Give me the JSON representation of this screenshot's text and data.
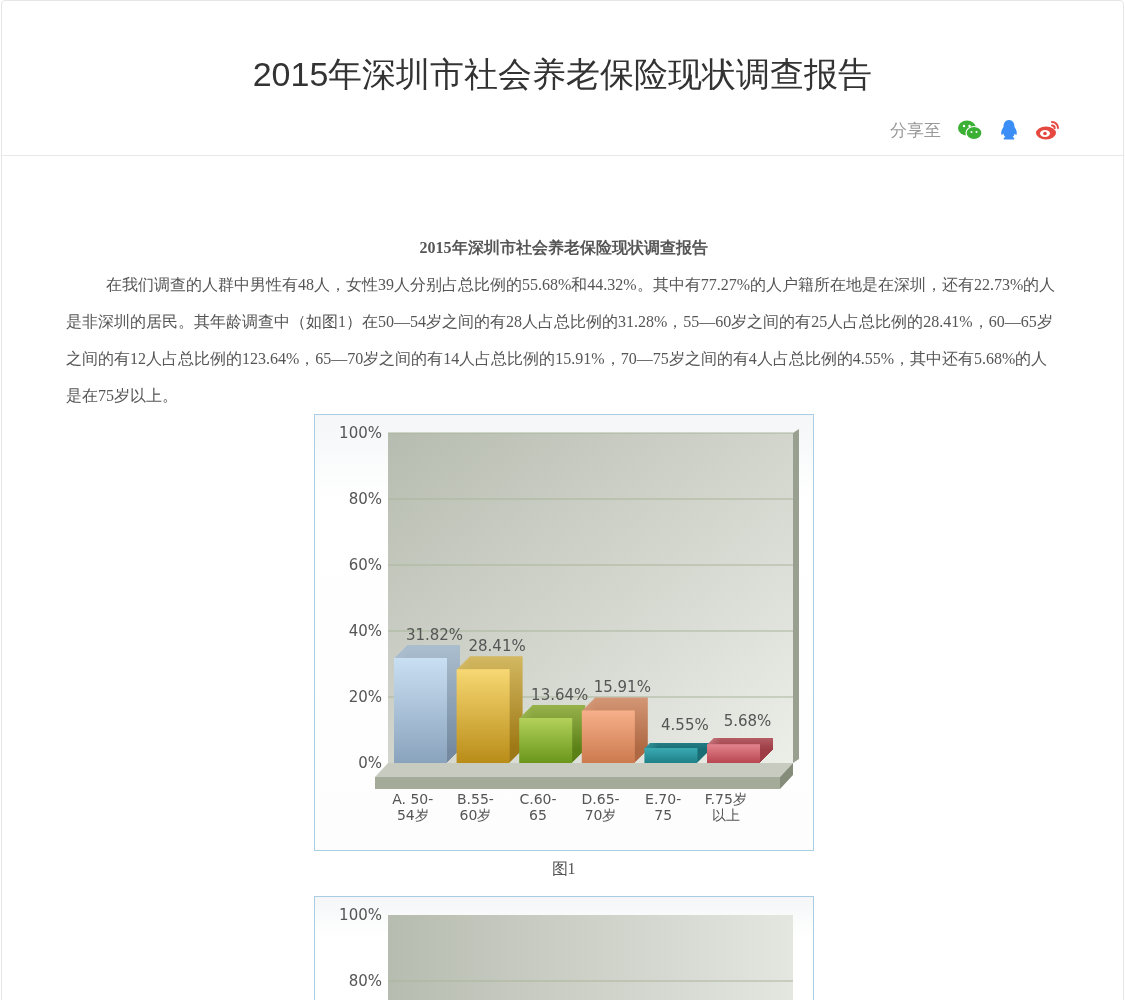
{
  "header": {
    "title": "2015年深圳市社会养老保险现状调查报告",
    "share_label": "分享至"
  },
  "article": {
    "heading": "2015年深圳市社会养老保险现状调查报告",
    "paragraph": "在我们调查的人群中男性有48人，女性39人分别占总比例的55.68%和44.32%。其中有77.27%的人户籍所在地是在深圳，还有22.73%的人是非深圳的居民。其年龄调查中（如图1）在50—54岁之间的有28人占总比例的31.28%，55—60岁之间的有25人占总比例的28.41%，60—65岁之间的有12人占总比例的123.64%，65—70岁之间的有14人占总比例的15.91%，70—75岁之间的有4人占总比例的4.55%，其中还有5.68%的人是在75岁以上。",
    "figure_1": {
      "caption": "图1",
      "chart_data": {
        "type": "bar",
        "categories": [
          "A. 50-54岁",
          "B.55-60岁",
          "C.60-65",
          "D.65-70岁",
          "E.70-75",
          "F.75岁以上"
        ],
        "values": [
          31.82,
          28.41,
          13.64,
          15.91,
          4.55,
          5.68
        ],
        "value_labels": [
          "31.82%",
          "28.41%",
          "13.64%",
          "15.91%",
          "4.55%",
          "5.68%"
        ],
        "ylim": [
          0,
          100
        ],
        "grid": true,
        "yticks": [
          {
            "value": 0,
            "label": "0%"
          },
          {
            "value": 20,
            "label": "20%"
          },
          {
            "value": 40,
            "label": "40%"
          },
          {
            "value": 60,
            "label": "60%"
          },
          {
            "value": 80,
            "label": "80%"
          },
          {
            "value": 100,
            "label": "100%"
          }
        ]
      }
    },
    "figure_2": {
      "axis_labels": [
        "100%",
        "80%"
      ]
    }
  }
}
